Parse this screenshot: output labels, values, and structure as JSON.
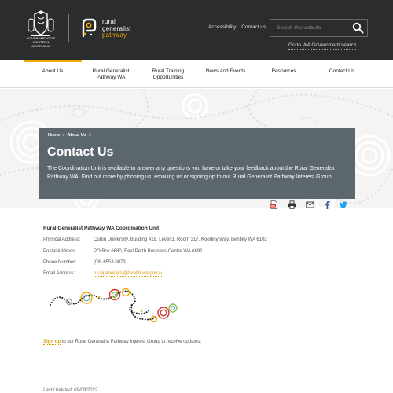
{
  "header": {
    "crest_text": "GOVERNMENT OF WESTERN AUSTRALIA",
    "logo_line1": "rural",
    "logo_line2": "generalist",
    "logo_line3": "pathway",
    "accessibility_link": "Accessibility",
    "contact_link": "Contact us",
    "search_placeholder": "Search this website",
    "wa_gov_link": "Go to WA Government search"
  },
  "nav": {
    "items": [
      {
        "label": "About Us"
      },
      {
        "label": "Rural Generalist Pathway WA"
      },
      {
        "label": "Rural Training Opportunities"
      },
      {
        "label": "News and Events"
      },
      {
        "label": "Resources"
      },
      {
        "label": "Contact Us"
      }
    ]
  },
  "breadcrumb": {
    "home": "Home",
    "about": "About Us",
    "separator": ">"
  },
  "hero": {
    "title": "Contact Us",
    "description": "The Coordination Unit is available to answer any questions you have or take your feedback about the Rural Generalist Pathway WA. Find out more by phoning us, emailing us or signing up to our Rural Generalist Pathway Interest Group."
  },
  "share": {
    "icons": [
      "pdf-icon",
      "print-icon",
      "email-icon",
      "facebook-icon",
      "twitter-icon"
    ]
  },
  "contact": {
    "unit_title": "Rural Generalist Pathway WA Coordination Unit",
    "physical_label": "Physical Address:",
    "physical_value": "Curtin University, Building 418, Level 3, Room 317, Koorliny Way, Bentley WA 6102",
    "postal_label": "Postal Address:",
    "postal_value": "PO Box 6680, East Perth Business Centre WA 6892",
    "phone_label": "Phone Number:",
    "phone_value": "(08) 6553 0873",
    "email_label": "Email Address:",
    "email_value": "ruralgeneralist@health.wa.gov.au"
  },
  "signup": {
    "link": "Sign up",
    "text": " to our Rural Generalist Pathway Interest Group to receive updates."
  },
  "footer": {
    "last_updated": "Last Updated: 09/09/2022"
  },
  "colors": {
    "header_bg": "#2b2c2e",
    "accent": "#f2a900",
    "hero_bg": "#5c666d"
  }
}
